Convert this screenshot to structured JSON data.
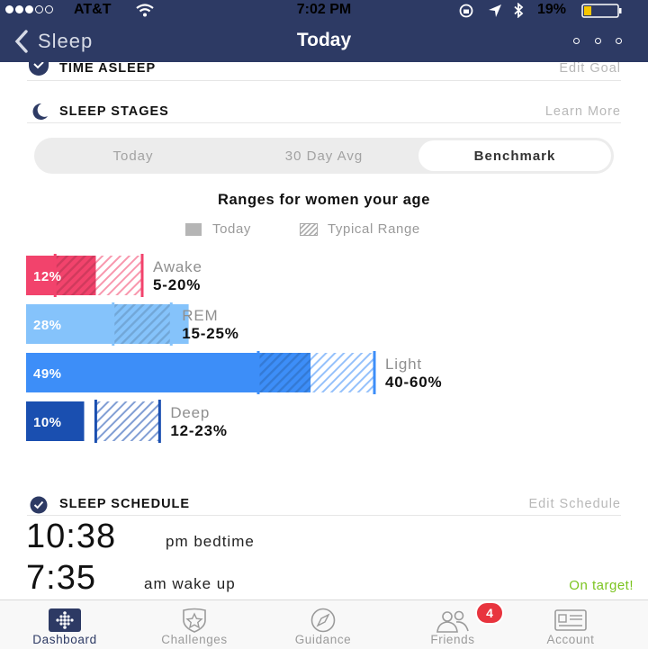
{
  "status_bar": {
    "carrier": "AT&T",
    "time": "7:02 PM",
    "battery": "19%"
  },
  "nav": {
    "back_label": "Sleep",
    "title": "Today"
  },
  "time_asleep": {
    "title": "TIME ASLEEP",
    "link": "Edit Goal"
  },
  "sleep_stages": {
    "title": "SLEEP STAGES",
    "link": "Learn More",
    "segments": [
      "Today",
      "30 Day Avg",
      "Benchmark"
    ],
    "selected_segment": "Benchmark",
    "chart_title": "Ranges for women your age",
    "legend": {
      "today": "Today",
      "typical": "Typical Range"
    }
  },
  "chart_data": {
    "type": "bar",
    "title": "Ranges for women your age",
    "series": [
      {
        "name": "Today",
        "values": [
          12,
          28,
          49,
          10
        ]
      },
      {
        "name": "Typical Range",
        "ranges": [
          [
            5,
            20
          ],
          [
            15,
            25
          ],
          [
            40,
            60
          ],
          [
            12,
            23
          ]
        ]
      }
    ],
    "categories": [
      "Awake",
      "REM",
      "Light",
      "Deep"
    ],
    "value_labels": [
      "12%",
      "28%",
      "49%",
      "10%"
    ],
    "range_labels": [
      "5-20%",
      "15-25%",
      "40-60%",
      "12-23%"
    ],
    "colors": [
      "#f2436c",
      "#85c3fb",
      "#3d8ef8",
      "#1a4fb0"
    ]
  },
  "sleep_schedule": {
    "title": "SLEEP SCHEDULE",
    "link": "Edit Schedule",
    "bedtime": "10:38",
    "bedtime_label": "pm bedtime",
    "wake": "7:35",
    "wake_label": "am wake up",
    "status": "On target!"
  },
  "tabs": [
    {
      "label": "Dashboard",
      "icon": "dashboard-icon",
      "active": true
    },
    {
      "label": "Challenges",
      "icon": "star-badge-icon",
      "active": false
    },
    {
      "label": "Guidance",
      "icon": "compass-icon",
      "active": false
    },
    {
      "label": "Friends",
      "icon": "friends-icon",
      "active": false,
      "badge": "4"
    },
    {
      "label": "Account",
      "icon": "account-card-icon",
      "active": false
    }
  ]
}
